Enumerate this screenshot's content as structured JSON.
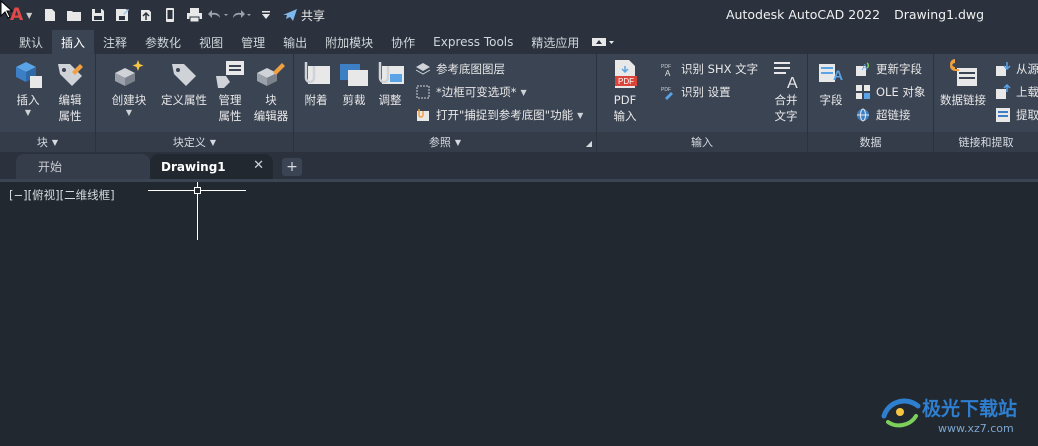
{
  "app": {
    "logo_letter": "A",
    "title_product": "Autodesk AutoCAD 2022",
    "title_file": "Drawing1.dwg"
  },
  "quick_access": {
    "share_label": "共享",
    "icons": [
      "new-file-icon",
      "open-folder-icon",
      "save-icon",
      "save-as-icon",
      "cloud-upload-icon",
      "mobile-icon",
      "print-icon",
      "undo-icon",
      "redo-icon",
      "customize-dropdown-icon"
    ]
  },
  "ribbon_tabs": [
    {
      "label": "默认"
    },
    {
      "label": "插入",
      "active": true
    },
    {
      "label": "注释"
    },
    {
      "label": "参数化"
    },
    {
      "label": "视图"
    },
    {
      "label": "管理"
    },
    {
      "label": "输出"
    },
    {
      "label": "附加模块"
    },
    {
      "label": "协作"
    },
    {
      "label": "Express Tools"
    },
    {
      "label": "精选应用"
    }
  ],
  "panels": {
    "block": {
      "title": "块",
      "insert": "插入",
      "edit_attr_1": "编辑",
      "edit_attr_2": "属性"
    },
    "block_def": {
      "title": "块定义",
      "create": "创建块",
      "define_attr": "定义属性",
      "manage_attr_1": "管理",
      "manage_attr_2": "属性",
      "block_editor_1": "块",
      "block_editor_2": "编辑器"
    },
    "reference": {
      "title": "参照",
      "attach": "附着",
      "clip": "剪裁",
      "adjust": "调整",
      "underlay_layers": "参考底图图层",
      "frames_variable": "*边框可变选项*",
      "snap_underlay": "打开\"捕捉到参考底图\"功能"
    },
    "import": {
      "title": "输入",
      "pdf_import_1": "PDF",
      "pdf_import_2": "输入",
      "recognize_shx": "识别 SHX 文字",
      "recognize_settings": "识别 设置",
      "combine_text_1": "合并",
      "combine_text_2": "文字"
    },
    "data": {
      "title": "数据",
      "field": "字段",
      "update_fields": "更新字段",
      "ole_object": "OLE 对象",
      "hyperlink": "超链接"
    },
    "link_extract": {
      "title": "链接和提取",
      "data_link": "数据链接",
      "from_source": "从源",
      "upload": "上载",
      "extract": "提取"
    }
  },
  "doc_tabs": {
    "start": "开始",
    "current": "Drawing1",
    "close": "✕",
    "add": "+"
  },
  "viewport": {
    "label": "[−][俯视][二维线框]"
  },
  "watermark": {
    "text": "极光下载站",
    "url": "www.xz7.com"
  },
  "colors": {
    "background": "#212830",
    "ribbon": "#3b4453",
    "titlebar": "#2b323d",
    "accent_blue": "#2e7fd0",
    "logo_red": "#e14949"
  }
}
